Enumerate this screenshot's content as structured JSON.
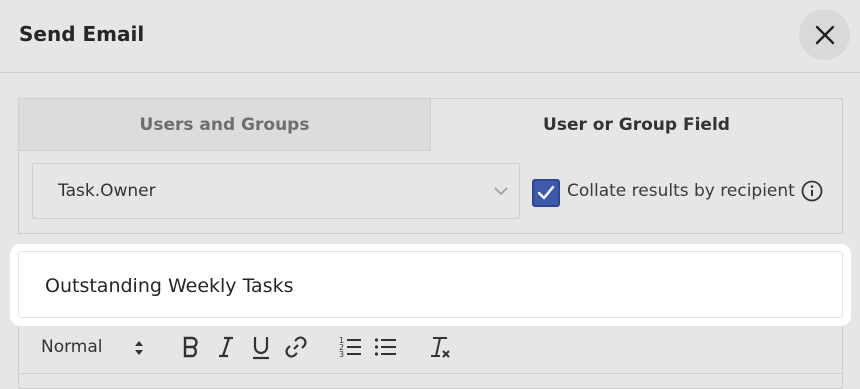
{
  "dialog": {
    "title": "Send Email",
    "close_icon": "close-icon"
  },
  "recipients": {
    "tabs": [
      {
        "label": "Users and Groups",
        "active": false
      },
      {
        "label": "User or Group Field",
        "active": true
      }
    ],
    "field_select": {
      "value": "Task.Owner",
      "icon": "chevron-down-icon"
    },
    "collate_checkbox": {
      "checked": true,
      "label": "Collate results by recipient"
    },
    "info_icon": "info-icon"
  },
  "subject": {
    "value": "Outstanding Weekly Tasks"
  },
  "editor_toolbar": {
    "format_select": "Normal",
    "buttons": [
      "bold-icon",
      "italic-icon",
      "underline-icon",
      "link-icon",
      "ordered-list-icon",
      "bullet-list-icon",
      "clear-format-icon"
    ]
  },
  "colors": {
    "background": "#e6e6e6",
    "checkbox_accent": "#3f5aa8",
    "highlight": "#ffffff"
  }
}
